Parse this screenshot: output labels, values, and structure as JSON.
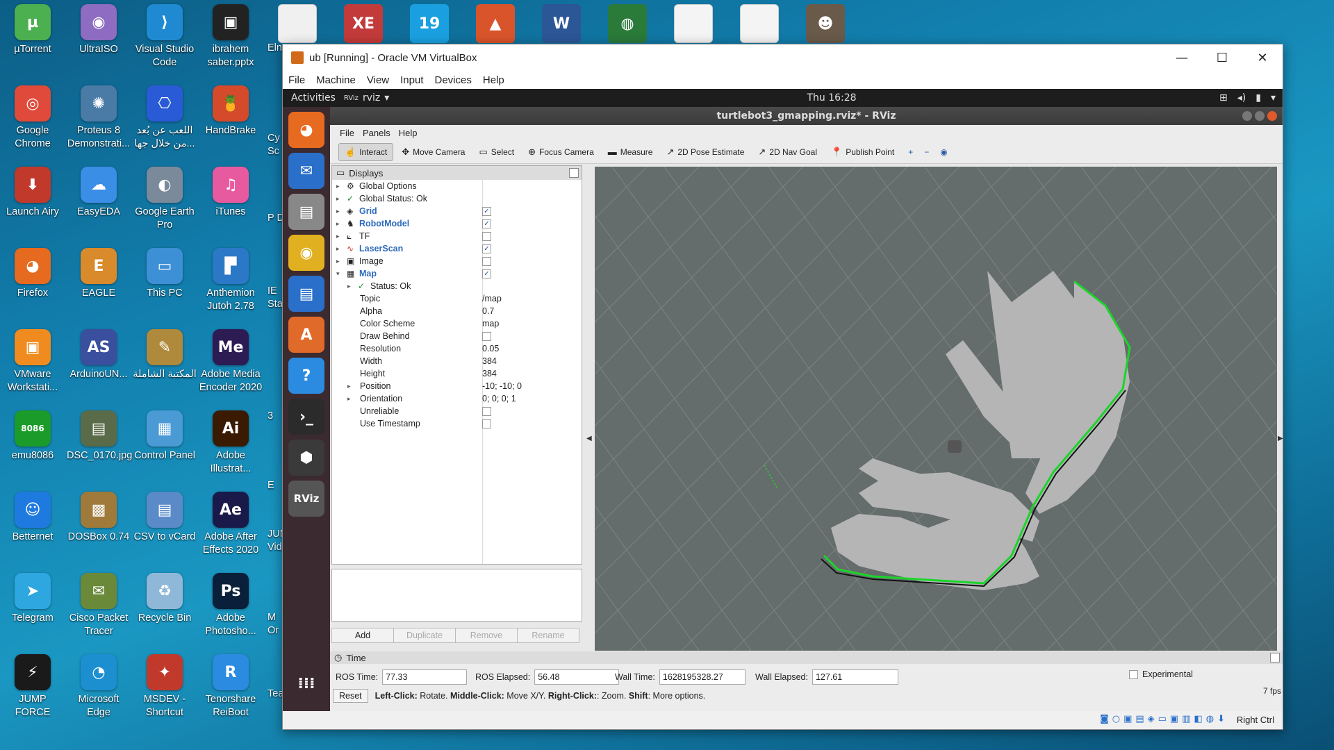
{
  "desktop_icons": [
    {
      "label": "µTorrent",
      "icon": "utorrent-icon",
      "color": "#4caf50",
      "glyph": "µ"
    },
    {
      "label": "UltraISO",
      "icon": "disc-icon",
      "color": "#8e6cc2",
      "glyph": "◉"
    },
    {
      "label": "Visual Studio Code",
      "icon": "vscode-icon",
      "color": "#1f8ad2",
      "glyph": "⟩"
    },
    {
      "label": "ibrahem saber.pptx",
      "icon": "pptx-thumb-icon",
      "color": "#222",
      "glyph": "▣"
    },
    {
      "label": "Google Chrome",
      "icon": "chrome-icon",
      "color": "#e04a3b",
      "glyph": "◎"
    },
    {
      "label": "Proteus 8 Demonstrati...",
      "icon": "proteus-icon",
      "color": "#4a7ba7",
      "glyph": "✺"
    },
    {
      "label": "اللعب عن بُعد من خلال جها...",
      "icon": "remote-play-icon",
      "color": "#2a5bd7",
      "glyph": "⎔"
    },
    {
      "label": "HandBrake",
      "icon": "handbrake-icon",
      "color": "#d44a2a",
      "glyph": "🍍"
    },
    {
      "label": "Launch Airy",
      "icon": "airy-icon",
      "color": "#c0392b",
      "glyph": "⬇"
    },
    {
      "label": "EasyEDA",
      "icon": "easyeda-icon",
      "color": "#3a8ee6",
      "glyph": "☁"
    },
    {
      "label": "Google Earth Pro",
      "icon": "google-earth-icon",
      "color": "#7a8a9a",
      "glyph": "◐"
    },
    {
      "label": "iTunes",
      "icon": "itunes-icon",
      "color": "#e85aa0",
      "glyph": "♫"
    },
    {
      "label": "Firefox",
      "icon": "firefox-icon",
      "color": "#e66a1f",
      "glyph": "◕"
    },
    {
      "label": "EAGLE",
      "icon": "eagle-icon",
      "color": "#d98a2b",
      "glyph": "E"
    },
    {
      "label": "This PC",
      "icon": "this-pc-icon",
      "color": "#3d8fd6",
      "glyph": "▭"
    },
    {
      "label": "Anthemion Jutoh 2.78",
      "icon": "jutoh-icon",
      "color": "#2b78c6",
      "glyph": "▛"
    },
    {
      "label": "VMware Workstati...",
      "icon": "vmware-icon",
      "color": "#f08c1f",
      "glyph": "▣"
    },
    {
      "label": "ArduinoUN...",
      "icon": "atmel-studio-icon",
      "color": "#3a4f9e",
      "glyph": "AS"
    },
    {
      "label": "المكتبة الشاملة",
      "icon": "book-icon",
      "color": "#b08a3c",
      "glyph": "✎"
    },
    {
      "label": "Adobe Media Encoder 2020",
      "icon": "media-encoder-icon",
      "color": "#2d1b54",
      "glyph": "Me"
    },
    {
      "label": "emu8086",
      "icon": "emu8086-icon",
      "color": "#1a9b2a",
      "glyph": "8086"
    },
    {
      "label": "DSC_0170.jpg",
      "icon": "photo-thumb-icon",
      "color": "#5a6b4a",
      "glyph": "▤"
    },
    {
      "label": "Control Panel",
      "icon": "control-panel-icon",
      "color": "#4a9ad6",
      "glyph": "▦"
    },
    {
      "label": "Adobe Illustrat...",
      "icon": "illustrator-icon",
      "color": "#3a1a00",
      "glyph": "Ai"
    },
    {
      "label": "Betternet",
      "icon": "betternet-icon",
      "color": "#1f7ae0",
      "glyph": "☺"
    },
    {
      "label": "DOSBox 0.74",
      "icon": "dosbox-icon",
      "color": "#a07a3a",
      "glyph": "▩"
    },
    {
      "label": "CSV to vCard",
      "icon": "vcard-icon",
      "color": "#5a8bc8",
      "glyph": "▤"
    },
    {
      "label": "Adobe After Effects 2020",
      "icon": "after-effects-icon",
      "color": "#1a1a4a",
      "glyph": "Ae"
    },
    {
      "label": "Telegram",
      "icon": "telegram-icon",
      "color": "#2ea6df",
      "glyph": "➤"
    },
    {
      "label": "Cisco Packet Tracer",
      "icon": "packet-tracer-icon",
      "color": "#6a8a3a",
      "glyph": "✉"
    },
    {
      "label": "Recycle Bin",
      "icon": "recycle-bin-icon",
      "color": "#8fb8d8",
      "glyph": "♻"
    },
    {
      "label": "Adobe Photosho...",
      "icon": "photoshop-icon",
      "color": "#0a1f3a",
      "glyph": "Ps"
    },
    {
      "label": "JUMP FORCE",
      "icon": "jump-force-icon",
      "color": "#1a1a1a",
      "glyph": "⚡"
    },
    {
      "label": "Microsoft Edge",
      "icon": "edge-icon",
      "color": "#1c8fd1",
      "glyph": "◔"
    },
    {
      "label": "MSDEV - Shortcut",
      "icon": "msdev-icon",
      "color": "#c0392b",
      "glyph": "✦"
    },
    {
      "label": "Tenorshare ReiBoot",
      "icon": "reiboot-icon",
      "color": "#2a8be0",
      "glyph": "R"
    }
  ],
  "partial_icons": [
    "Elna",
    "Cy Sc",
    "P D",
    "IE Sta",
    "3",
    "E",
    "JUN Vid",
    "M Or",
    "Tea"
  ],
  "top_tiles": [
    {
      "icon": "blank-file-icon",
      "color": "#f0f0f0",
      "glyph": ""
    },
    {
      "icon": "oracle-xe-icon",
      "color": "#c23a3a",
      "glyph": "XE"
    },
    {
      "icon": "calendar-19-icon",
      "color": "#1aa0e0",
      "glyph": "19"
    },
    {
      "icon": "matlab-icon",
      "color": "#d9542b",
      "glyph": "▲"
    },
    {
      "icon": "word-icon",
      "color": "#2b5797",
      "glyph": "W"
    },
    {
      "icon": "network-globe-icon",
      "color": "#2a7a3a",
      "glyph": "◍"
    },
    {
      "icon": "doc-thumb-icon",
      "color": "#f4f4f4",
      "glyph": ""
    },
    {
      "icon": "doc-thumb-icon",
      "color": "#f4f4f4",
      "glyph": ""
    },
    {
      "icon": "person-photo-icon",
      "color": "#6a5a4a",
      "glyph": "☻"
    }
  ],
  "vbox": {
    "title": "ub [Running] - Oracle VM VirtualBox",
    "menu": [
      "File",
      "Machine",
      "View",
      "Input",
      "Devices",
      "Help"
    ],
    "host_key": "Right Ctrl"
  },
  "gnome": {
    "activities": "Activities",
    "app": "rviz",
    "clock": "Thu 16:28"
  },
  "dock": [
    {
      "icon": "firefox-icon",
      "color": "#e66a1f",
      "glyph": "◕"
    },
    {
      "icon": "thunderbird-icon",
      "color": "#2a6fc9",
      "glyph": "✉"
    },
    {
      "icon": "files-icon",
      "color": "#888",
      "glyph": "▤"
    },
    {
      "icon": "rhythmbox-icon",
      "color": "#e0b020",
      "glyph": "◉"
    },
    {
      "icon": "writer-icon",
      "color": "#2a6fc9",
      "glyph": "▤"
    },
    {
      "icon": "software-icon",
      "color": "#e06a2a",
      "glyph": "A"
    },
    {
      "icon": "help-icon",
      "color": "#2a8be0",
      "glyph": "?"
    },
    {
      "icon": "terminal-icon",
      "color": "#2b2b2b",
      "glyph": "›_"
    },
    {
      "icon": "virtualbox-guest-icon",
      "color": "#3a3a3a",
      "glyph": "⬢"
    },
    {
      "icon": "rviz-icon",
      "color": "#555",
      "glyph": "RViz"
    }
  ],
  "rviz": {
    "title": "turtlebot3_gmapping.rviz* - RViz",
    "menu": [
      "File",
      "Panels",
      "Help"
    ],
    "tools": [
      {
        "label": "Interact",
        "icon": "interact-icon",
        "glyph": "☝",
        "active": true
      },
      {
        "label": "Move Camera",
        "icon": "move-camera-icon",
        "glyph": "✥",
        "active": false
      },
      {
        "label": "Select",
        "icon": "select-icon",
        "glyph": "▭",
        "active": false
      },
      {
        "label": "Focus Camera",
        "icon": "focus-camera-icon",
        "glyph": "⊕",
        "active": false
      },
      {
        "label": "Measure",
        "icon": "measure-icon",
        "glyph": "▬",
        "active": false
      },
      {
        "label": "2D Pose Estimate",
        "icon": "pose-estimate-icon",
        "glyph": "↗",
        "active": false
      },
      {
        "label": "2D Nav Goal",
        "icon": "nav-goal-icon",
        "glyph": "↗",
        "active": false
      },
      {
        "label": "Publish Point",
        "icon": "publish-point-icon",
        "glyph": "📍",
        "active": false
      }
    ],
    "displays_title": "Displays",
    "displays": [
      {
        "label": "Global Options",
        "icon": "gear-icon",
        "glyph": "⚙",
        "indent": 0,
        "arrow": "▸",
        "bold": false,
        "check": null,
        "value": ""
      },
      {
        "label": "Global Status: Ok",
        "icon": "check-icon",
        "glyph": "✓",
        "indent": 0,
        "arrow": "▸",
        "bold": false,
        "check": null,
        "value": ""
      },
      {
        "label": "Grid",
        "icon": "grid-icon",
        "glyph": "◈",
        "indent": 0,
        "arrow": "▸",
        "bold": true,
        "check": true,
        "value": ""
      },
      {
        "label": "RobotModel",
        "icon": "robot-icon",
        "glyph": "♞",
        "indent": 0,
        "arrow": "▸",
        "bold": true,
        "check": true,
        "value": ""
      },
      {
        "label": "TF",
        "icon": "tf-icon",
        "glyph": "⟀",
        "indent": 0,
        "arrow": "▸",
        "bold": false,
        "check": false,
        "value": ""
      },
      {
        "label": "LaserScan",
        "icon": "laserscan-icon",
        "glyph": "∿",
        "indent": 0,
        "arrow": "▸",
        "bold": true,
        "check": true,
        "value": ""
      },
      {
        "label": "Image",
        "icon": "image-icon",
        "glyph": "▣",
        "indent": 0,
        "arrow": "▸",
        "bold": false,
        "check": false,
        "value": ""
      },
      {
        "label": "Map",
        "icon": "map-icon",
        "glyph": "▦",
        "indent": 0,
        "arrow": "▾",
        "bold": true,
        "check": true,
        "value": ""
      },
      {
        "label": "Status: Ok",
        "icon": "check-icon",
        "glyph": "✓",
        "indent": 1,
        "arrow": "▸",
        "bold": false,
        "check": null,
        "value": ""
      },
      {
        "label": "Topic",
        "icon": "",
        "glyph": "",
        "indent": 1,
        "arrow": "",
        "bold": false,
        "check": null,
        "value": "/map"
      },
      {
        "label": "Alpha",
        "icon": "",
        "glyph": "",
        "indent": 1,
        "arrow": "",
        "bold": false,
        "check": null,
        "value": "0.7"
      },
      {
        "label": "Color Scheme",
        "icon": "",
        "glyph": "",
        "indent": 1,
        "arrow": "",
        "bold": false,
        "check": null,
        "value": "map"
      },
      {
        "label": "Draw Behind",
        "icon": "",
        "glyph": "",
        "indent": 1,
        "arrow": "",
        "bold": false,
        "check": false,
        "value": ""
      },
      {
        "label": "Resolution",
        "icon": "",
        "glyph": "",
        "indent": 1,
        "arrow": "",
        "bold": false,
        "check": null,
        "value": "0.05"
      },
      {
        "label": "Width",
        "icon": "",
        "glyph": "",
        "indent": 1,
        "arrow": "",
        "bold": false,
        "check": null,
        "value": "384"
      },
      {
        "label": "Height",
        "icon": "",
        "glyph": "",
        "indent": 1,
        "arrow": "",
        "bold": false,
        "check": null,
        "value": "384"
      },
      {
        "label": "Position",
        "icon": "",
        "glyph": "",
        "indent": 1,
        "arrow": "▸",
        "bold": false,
        "check": null,
        "value": "-10; -10; 0"
      },
      {
        "label": "Orientation",
        "icon": "",
        "glyph": "",
        "indent": 1,
        "arrow": "▸",
        "bold": false,
        "check": null,
        "value": "0; 0; 0; 1"
      },
      {
        "label": "Unreliable",
        "icon": "",
        "glyph": "",
        "indent": 1,
        "arrow": "",
        "bold": false,
        "check": false,
        "value": ""
      },
      {
        "label": "Use Timestamp",
        "icon": "",
        "glyph": "",
        "indent": 1,
        "arrow": "",
        "bold": false,
        "check": false,
        "value": ""
      }
    ],
    "buttons": {
      "add": "Add",
      "duplicate": "Duplicate",
      "remove": "Remove",
      "rename": "Rename"
    },
    "time": {
      "title": "Time",
      "ros_time_label": "ROS Time:",
      "ros_time": "77.33",
      "ros_elapsed_label": "ROS Elapsed:",
      "ros_elapsed": "56.48",
      "wall_time_label": "Wall Time:",
      "wall_time": "1628195328.27",
      "wall_elapsed_label": "Wall Elapsed:",
      "wall_elapsed": "127.61",
      "experimental": "Experimental"
    },
    "reset": "Reset",
    "help_parts": [
      "Left-Click:",
      " Rotate. ",
      "Middle-Click:",
      " Move X/Y. ",
      "Right-Click:",
      ": Zoom. ",
      "Shift",
      ": More options."
    ],
    "fps": "7 fps"
  }
}
